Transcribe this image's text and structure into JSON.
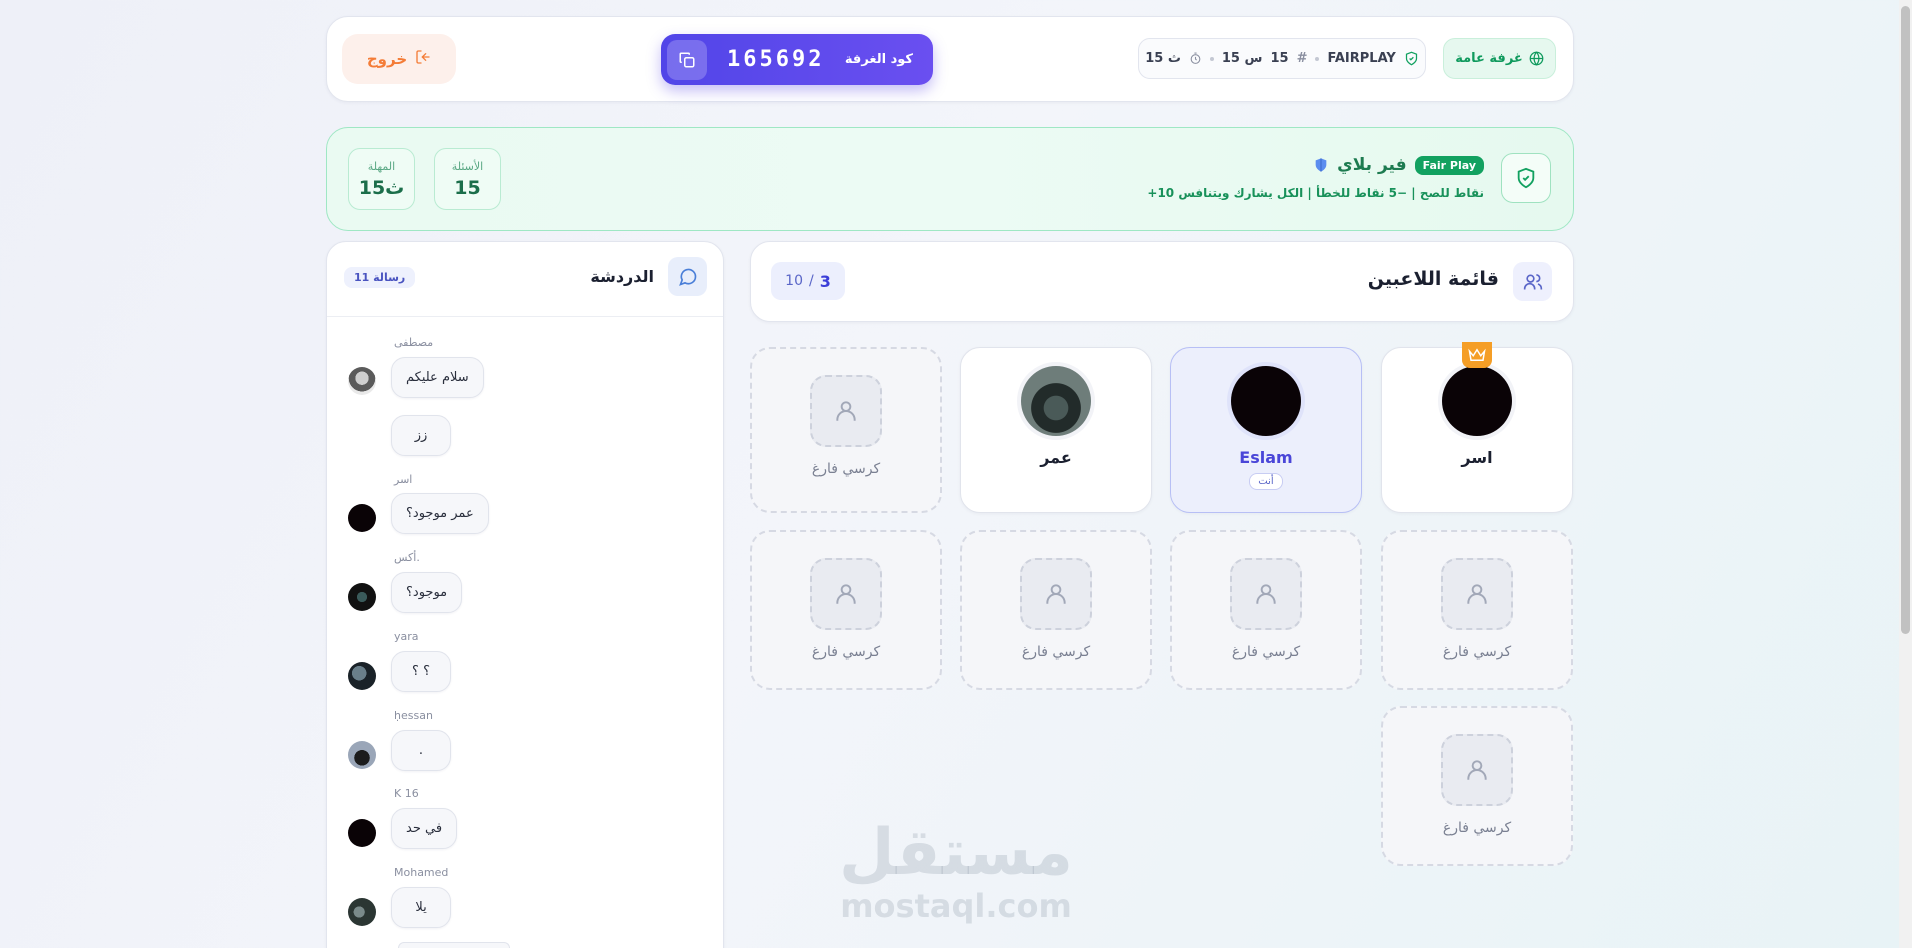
{
  "header": {
    "exit_label": "خروج",
    "room_code_label": "كود الغرفة",
    "room_code": "165692",
    "mode": "FAIRPLAY",
    "questions": "15",
    "time": "15 س",
    "timer": "15 ث",
    "room_type": "غرفة عامة"
  },
  "fairplay": {
    "badge": "Fair Play",
    "title": "فير بلاي",
    "subtitle": "+10 نقاط للصح | −5 نقاط للخطأ | الكل يشارك ويتنافس",
    "stats": [
      {
        "label": "الأسئلة",
        "value": "15"
      },
      {
        "label": "المهلة",
        "value": "15ث"
      }
    ]
  },
  "players": {
    "title": "قائمة اللاعبين",
    "current": "3",
    "max": "10",
    "empty_seat_label": "كرسي فارغ",
    "seats": [
      {
        "name": "اسر",
        "host": true
      },
      {
        "name": "Eslam",
        "you": true,
        "you_label": "أنت"
      },
      {
        "name": "عمر"
      }
    ]
  },
  "chat": {
    "title": "الدردشة",
    "count": "11 رسالة",
    "messages": [
      {
        "sender": "مصطفى",
        "text": "سلام عليكم"
      },
      {
        "sender": "",
        "text": "زز"
      },
      {
        "sender": "اسر",
        "text": "عمر موجود؟"
      },
      {
        "sender": "أكس.",
        "text": "موجود؟"
      },
      {
        "sender": "yara",
        "text": "؟ ؟"
      },
      {
        "sender": "ḥessan",
        "text": "."
      },
      {
        "sender": "K 16",
        "text": "في حد"
      },
      {
        "sender": "Mohamed",
        "text": "يلا"
      }
    ]
  },
  "watermark": {
    "arabic": "مستقل",
    "latin": "mostaql.com"
  },
  "colors": {
    "accent": "#5145e8",
    "fairplay_green": "#12a160",
    "exit_orange": "#f47c37",
    "crown": "#f59e26"
  }
}
